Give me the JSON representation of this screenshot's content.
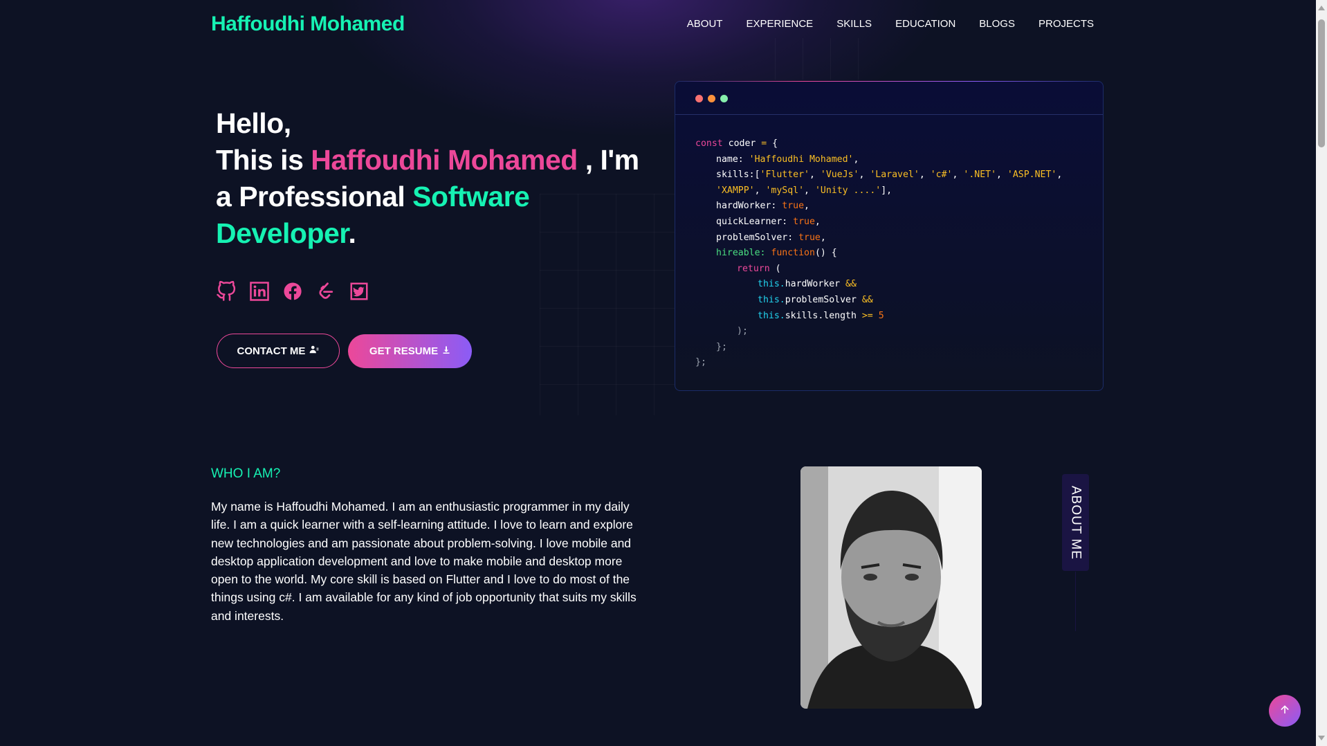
{
  "brand": {
    "name": "Haffoudhi Mohamed"
  },
  "nav": {
    "items": [
      "ABOUT",
      "EXPERIENCE",
      "SKILLS",
      "EDUCATION",
      "BLOGS",
      "PROJECTS"
    ]
  },
  "hero": {
    "hello": "Hello,",
    "this_is": "This is ",
    "name": "Haffoudhi Mohamed",
    "im": " , I'm",
    "a_professional": "a Professional ",
    "role": "Software Developer",
    "period": ".",
    "socials": [
      "github-icon",
      "linkedin-icon",
      "facebook-icon",
      "leetcode-icon",
      "twitter-icon"
    ],
    "contact_label": "CONTACT ME",
    "resume_label": "GET RESUME"
  },
  "code_card": {
    "dot_colors": [
      "#f87171",
      "#fb923c",
      "#86efac"
    ],
    "lines": [
      "const coder = {",
      "name: 'Haffoudhi Mohamed',",
      "skills:['Flutter', 'VueJs', 'Laravel', 'c#', '.NET', 'ASP.NET',",
      "'XAMPP', 'mySql', 'Unity ....'],",
      "hardWorker: true,",
      "quickLearner: true,",
      "problemSolver: true,",
      "hireable: function() {",
      "return (",
      "this.hardWorker &&",
      "this.problemSolver &&",
      "this.skills.length >= 5",
      ");",
      "};",
      "};"
    ]
  },
  "about": {
    "heading": "WHO I AM?",
    "paragraph": "My name is Haffoudhi Mohamed. I am an enthusiastic programmer in my daily life. I am a quick learner with a self-learning attitude. I love to learn and explore new technologies and am passionate about problem-solving. I love mobile and desktop application development and love to make mobile and desktop more open to the world. My core skill is based on Flutter and I love to do most of the things using c#. I am available for any kind of job opportunity that suits my skills and interests.",
    "side_tab": "ABOUT ME"
  },
  "colors": {
    "background": "#0d1224",
    "accent_pink": "#ec4899",
    "accent_green": "#16f2b3",
    "accent_violet": "#8b5cf6"
  }
}
